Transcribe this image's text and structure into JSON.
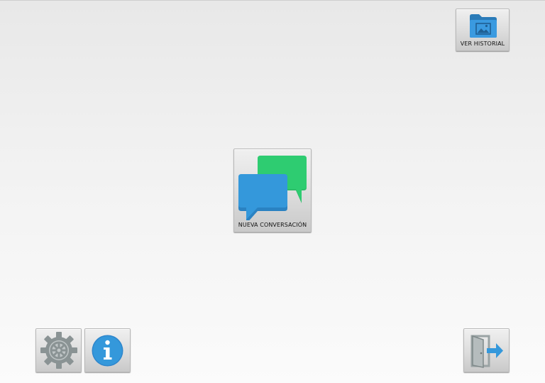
{
  "buttons": {
    "history": {
      "label": "VER HISTORIAL",
      "icon": "folder-image-icon"
    },
    "new_conversation": {
      "label": "NUEVA CONVERSACIÓN",
      "icon": "chat-bubbles-icon"
    },
    "settings": {
      "icon": "gear-icon"
    },
    "info": {
      "icon": "info-icon"
    },
    "exit": {
      "icon": "exit-door-icon"
    }
  },
  "colors": {
    "background_top": "#e8e8e8",
    "background_bottom": "#fbfbfb",
    "tile_top": "#f0f0f0",
    "tile_bottom": "#c9c9c9",
    "accent_blue": "#3498db",
    "accent_green": "#2ecc71",
    "gear_gray": "#8a9394"
  }
}
